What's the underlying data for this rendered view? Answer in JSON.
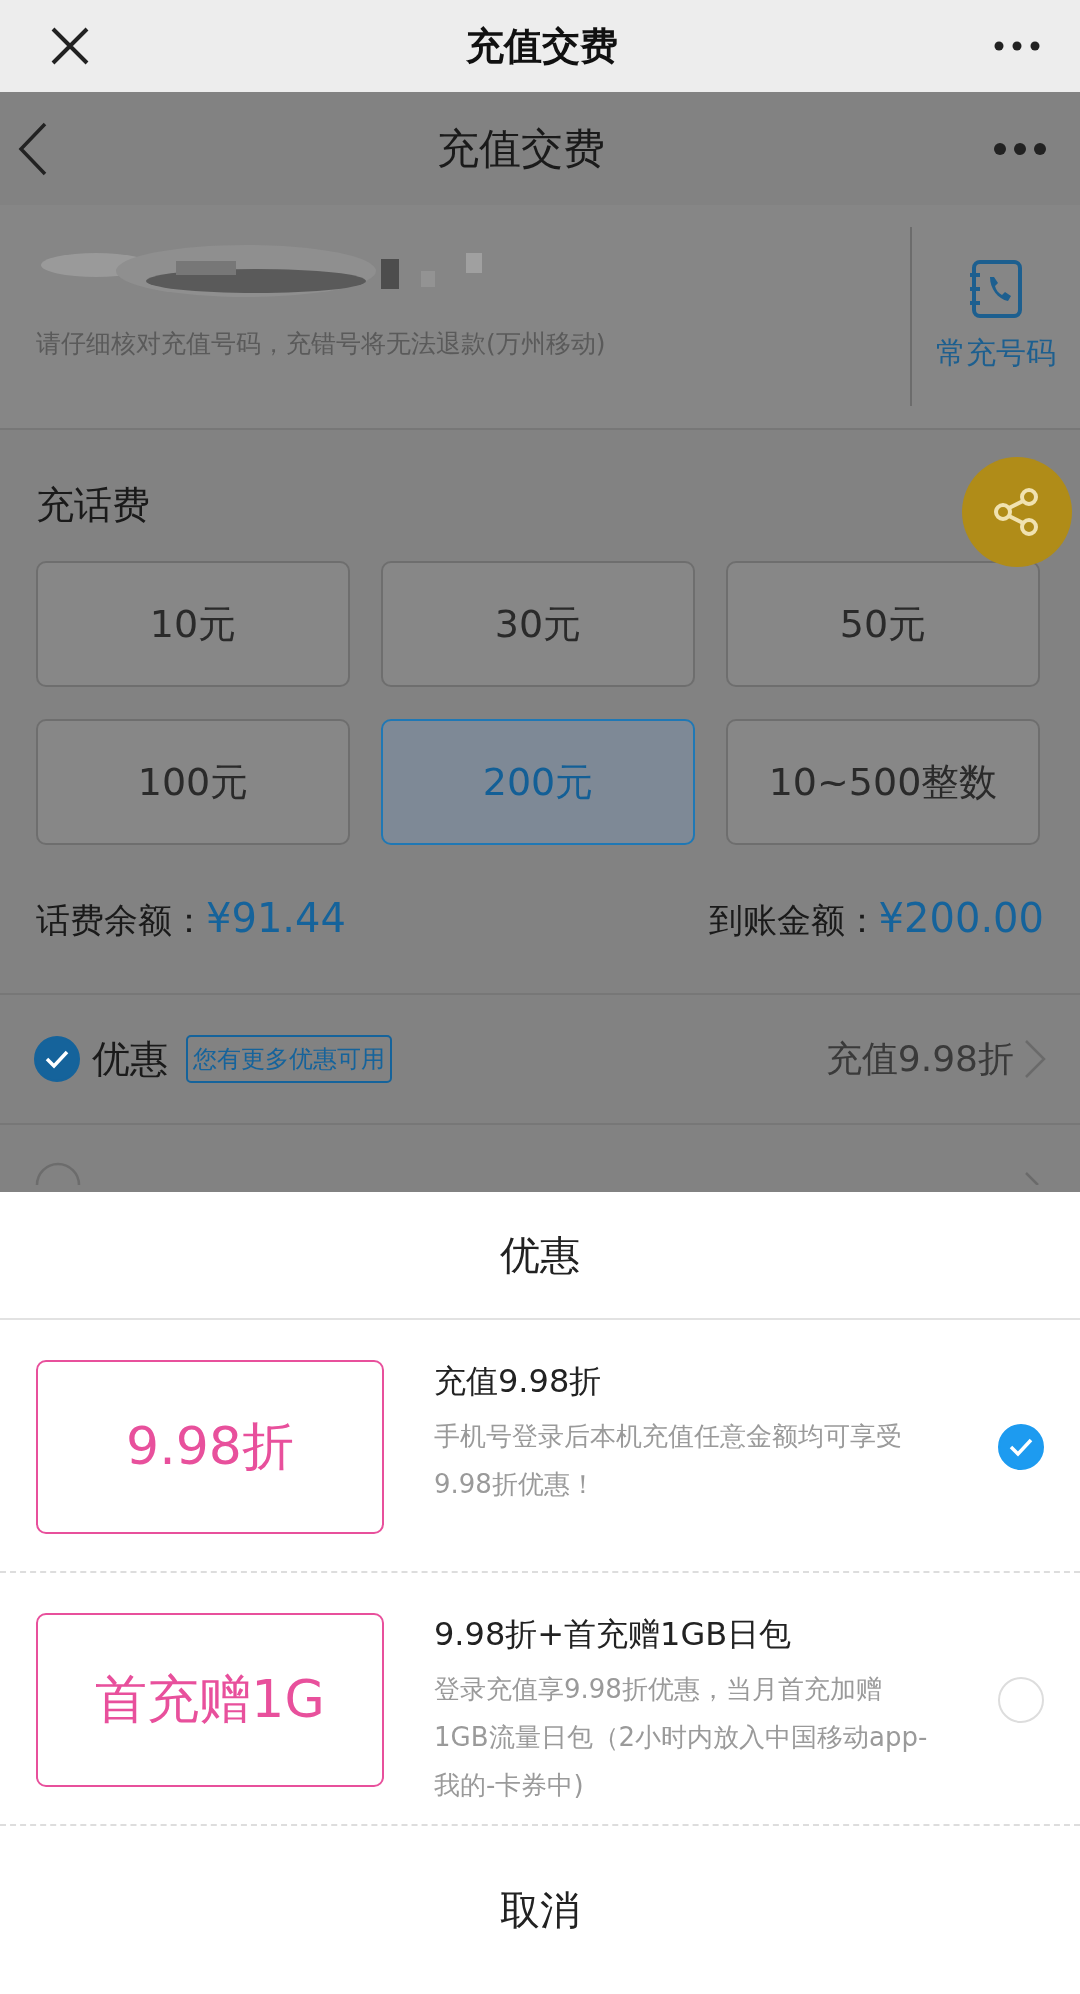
{
  "top_bar": {
    "title": "充值交费"
  },
  "nav_bar": {
    "title": "充值交费"
  },
  "number_section": {
    "hint": "请仔细核对充值号码，充错号将无法退款(万州移动)",
    "contacts_label": "常充号码"
  },
  "recharge": {
    "title": "充话费",
    "amounts": [
      {
        "label": "10元",
        "selected": false
      },
      {
        "label": "30元",
        "selected": false
      },
      {
        "label": "50元",
        "selected": false
      },
      {
        "label": "100元",
        "selected": false
      },
      {
        "label": "200元",
        "selected": true
      },
      {
        "label": "10~500整数",
        "selected": false
      }
    ],
    "balance_label": "话费余额：",
    "balance": "¥91.44",
    "arrival_label": "到账金额：",
    "arrival": "¥200.00"
  },
  "promo_row": {
    "checked": true,
    "label": "优惠",
    "tag": "您有更多优惠可用",
    "value": "充值9.98折"
  },
  "sheet": {
    "title": "优惠",
    "options": [
      {
        "badge": "9.98折",
        "title": "充值9.98折",
        "description": "手机号登录后本机充值任意金额均可享受9.98折优惠！",
        "selected": true
      },
      {
        "badge": "首充赠1G",
        "title": "9.98折+首充赠1GB日包",
        "description": "登录充值享9.98折优惠，当月首充加赠1GB流量日包（2小时内放入中国移动app-我的-卡券中)",
        "selected": false
      }
    ],
    "cancel": "取消"
  }
}
